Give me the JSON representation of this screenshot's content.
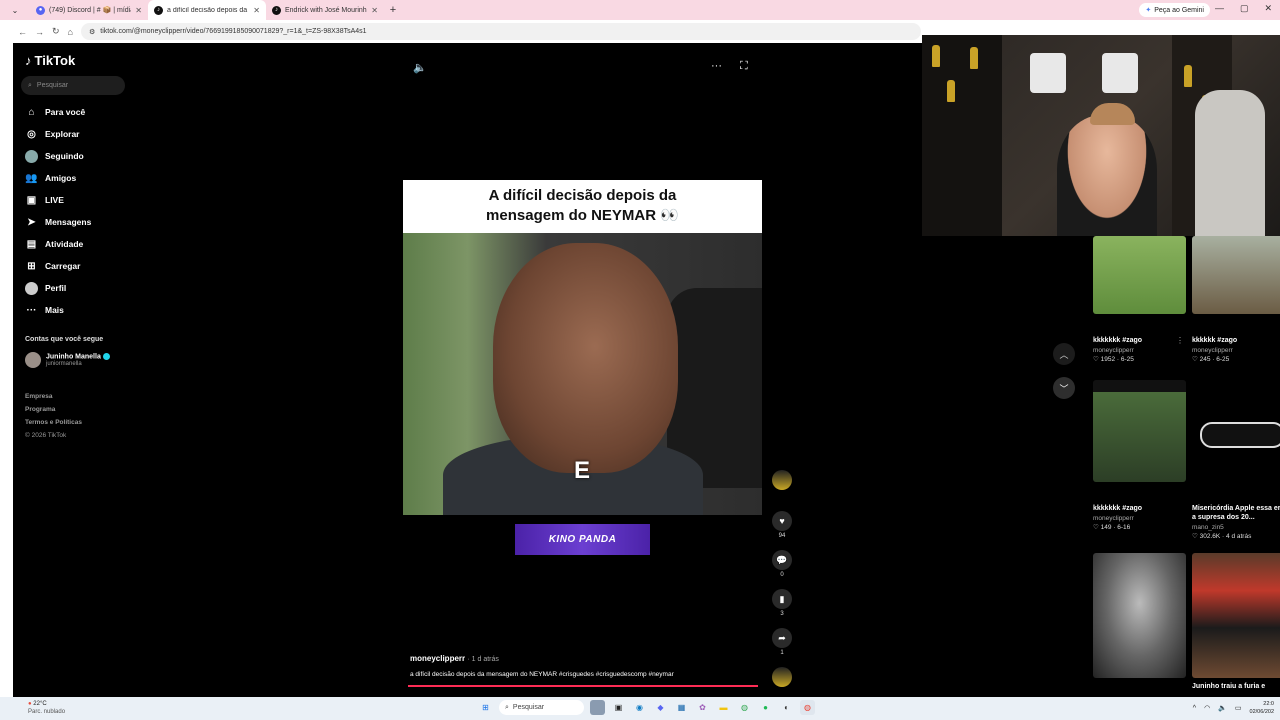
{
  "browser": {
    "tabs": [
      {
        "title": "(749) Discord | # 📦 | mídias-tim",
        "icon": "discord-icon"
      },
      {
        "title": "a difícil decisão depois da men",
        "icon": "tiktok-icon"
      },
      {
        "title": "Endrick with José Mourinho 👀",
        "icon": "tiktok-icon"
      }
    ],
    "new_tab": "+",
    "gemini_label": "Peça ao Gemini",
    "url": "tiktok.com/@moneyclipperr/video/7669199185090071829?_r=1&_t=ZS-98X38TsA4s1"
  },
  "sidebar": {
    "brand": "TikTok",
    "search_placeholder": "Pesquisar",
    "nav": [
      {
        "label": "Para você",
        "icon": "home-icon"
      },
      {
        "label": "Explorar",
        "icon": "compass-icon"
      },
      {
        "label": "Seguindo",
        "icon": "avatar-icon"
      },
      {
        "label": "Amigos",
        "icon": "friends-icon"
      },
      {
        "label": "LIVE",
        "icon": "live-icon"
      },
      {
        "label": "Mensagens",
        "icon": "send-icon"
      },
      {
        "label": "Atividade",
        "icon": "inbox-icon"
      },
      {
        "label": "Carregar",
        "icon": "upload-icon"
      },
      {
        "label": "Perfil",
        "icon": "profile-icon"
      },
      {
        "label": "Mais",
        "icon": "more-icon"
      }
    ],
    "following_heading": "Contas que você segue",
    "following": [
      {
        "name": "Juninho Manella",
        "username": "juniormanella"
      }
    ],
    "footer": [
      "Empresa",
      "Programa",
      "Termos e Políticas",
      "© 2026 TikTok"
    ]
  },
  "video": {
    "title_line1": "A difícil decisão depois da",
    "title_line2": "mensagem do NEYMAR 👀",
    "caption_letter": "E",
    "banner": "KINO PANDA",
    "author": "moneyclipperr",
    "time_ago": "· 1 d atrás",
    "description": "a difícil decisão depois da mensagem do NEYMAR #crisguedes #crisguedescomp #neymar",
    "likes": "94",
    "comments": "0",
    "saves": "3",
    "shares": "1"
  },
  "related": [
    {
      "title": "kkkkkkk #zago",
      "author": "moneyclipperr",
      "likes": "1952",
      "date": "6-25"
    },
    {
      "title": "kkkkkk #zago",
      "author": "moneyclipperr",
      "likes": "245",
      "date": "6-25"
    },
    {
      "title": "kkkkkkk #zago",
      "author": "moneyclipperr",
      "likes": "149",
      "date": "6-16"
    },
    {
      "title": "Misericórdia Apple essa era a supresa dos 20...",
      "author": "mano_zin5",
      "likes": "302.6K",
      "date": "4 d atrás"
    },
    {
      "title": "",
      "author": "",
      "likes": "",
      "date": ""
    },
    {
      "title": "Juninho traiu a furia e",
      "author": "",
      "likes": "",
      "date": ""
    }
  ],
  "taskbar": {
    "temp": "22°C",
    "weather": "Parc. nublado",
    "search_placeholder": "Pesquisar",
    "time": "22:0",
    "date": "02/06/202"
  },
  "colors": {
    "accent": "#fe2c55",
    "tab_bar": "#f9d9e3",
    "banner": "#5a2fc0"
  }
}
